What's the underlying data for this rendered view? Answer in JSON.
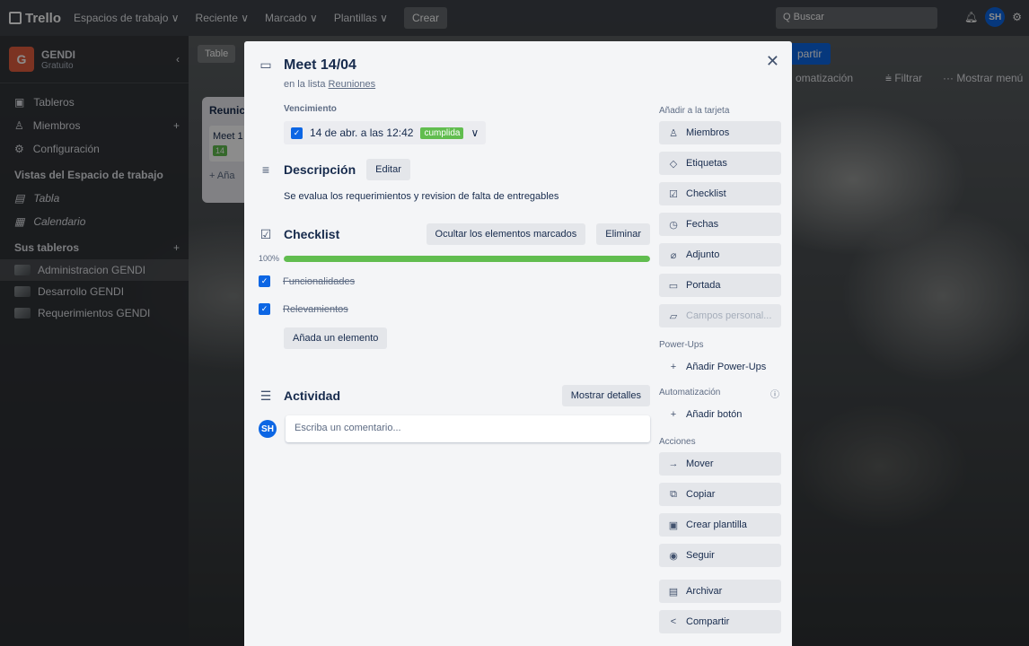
{
  "nav": {
    "logo": "Trello",
    "items": [
      "Espacios de trabajo ∨",
      "Reciente ∨",
      "Marcado ∨",
      "Plantillas ∨"
    ],
    "create": "Crear",
    "search_placeholder": "Buscar",
    "avatar": "SH"
  },
  "sidebar": {
    "workspace_initial": "G",
    "workspace_name": "GENDI",
    "workspace_plan": "Gratuito",
    "items": [
      {
        "label": "Tableros"
      },
      {
        "label": "Miembros"
      },
      {
        "label": "Configuración"
      }
    ],
    "views_title": "Vistas del Espacio de trabajo",
    "views": [
      {
        "label": "Tabla"
      },
      {
        "label": "Calendario"
      }
    ],
    "boards_title": "Sus tableros",
    "boards": [
      {
        "label": "Administracion GENDI",
        "active": true
      },
      {
        "label": "Desarrollo GENDI"
      },
      {
        "label": "Requerimientos GENDI"
      }
    ]
  },
  "board": {
    "tab": "Table",
    "share": "partir",
    "automation": "omatización",
    "filter": "Filtrar",
    "menu": "Mostrar menú",
    "list_title": "Reunic",
    "card_title": "Meet 1",
    "card_badge": "14",
    "add": "+ Aña"
  },
  "card": {
    "title": "Meet 14/04",
    "list_prefix": "en la lista",
    "list_name": "Reuniones",
    "due_label": "Vencimiento",
    "due_date": "14 de abr. a las 12:42",
    "due_status": "cumplida",
    "description_title": "Descripción",
    "edit_button": "Editar",
    "description": "Se evalua los requerimientos y revision de falta de entregables",
    "checklist_title": "Checklist",
    "hide_checked": "Ocultar los elementos marcados",
    "delete": "Eliminar",
    "progress_label": "100%",
    "progress": 1.0,
    "checklist_items": [
      {
        "label": "Funcionalidades",
        "checked": true
      },
      {
        "label": "Relevamientos",
        "checked": true
      }
    ],
    "add_item": "Añada un elemento",
    "activity_title": "Actividad",
    "show_details": "Mostrar detalles",
    "comment_avatar": "SH",
    "comment_placeholder": "Escriba un comentario..."
  },
  "side": {
    "add_to_card": "Añadir a la tarjeta",
    "add_items": [
      {
        "label": "Miembros",
        "icon": "person-icon"
      },
      {
        "label": "Etiquetas",
        "icon": "tag-icon"
      },
      {
        "label": "Checklist",
        "icon": "checklist-icon"
      },
      {
        "label": "Fechas",
        "icon": "clock-icon"
      },
      {
        "label": "Adjunto",
        "icon": "paperclip-icon"
      },
      {
        "label": "Portada",
        "icon": "cover-icon"
      },
      {
        "label": "Campos personal...",
        "icon": "fields-icon"
      }
    ],
    "powerups_title": "Power-Ups",
    "add_powerups": "Añadir Power-Ups",
    "automation_title": "Automatización",
    "add_button": "Añadir botón",
    "actions_title": "Acciones",
    "actions": [
      {
        "label": "Mover",
        "icon": "arrow-right-icon"
      },
      {
        "label": "Copiar",
        "icon": "copy-icon"
      },
      {
        "label": "Crear plantilla",
        "icon": "template-icon"
      },
      {
        "label": "Seguir",
        "icon": "eye-icon"
      },
      {
        "label": "Archivar",
        "icon": "archive-icon"
      },
      {
        "label": "Compartir",
        "icon": "share-icon"
      }
    ]
  }
}
